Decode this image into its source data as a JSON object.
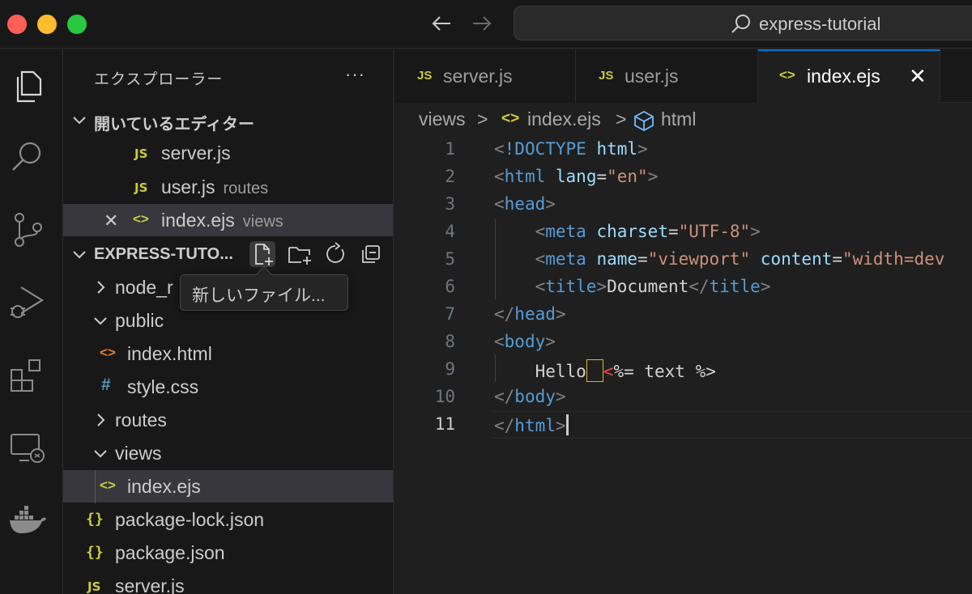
{
  "window": {
    "search_text": "express-tutorial"
  },
  "activity_bar": {
    "items": [
      "files-icon",
      "search-icon",
      "source-control-icon",
      "run-debug-icon",
      "extensions-icon",
      "remote-explorer-icon",
      "docker-icon"
    ]
  },
  "sidebar": {
    "title": "エクスプローラー",
    "more": "···",
    "open_editors_header": "開いているエディター",
    "open_editors": [
      {
        "name": "server.js",
        "desc": "",
        "icon": "JS"
      },
      {
        "name": "user.js",
        "desc": "routes",
        "icon": "JS"
      },
      {
        "name": "index.ejs",
        "desc": "views",
        "icon": "<>"
      }
    ],
    "project_header": "EXPRESS-TUTO...",
    "tooltip": "新しいファイル...",
    "tree": [
      {
        "name": "node_modules_visible",
        "label": "node_r"
      },
      {
        "label": "public"
      },
      {
        "label": "index.html",
        "icon": "<>"
      },
      {
        "label": "style.css",
        "icon": "#"
      },
      {
        "label": "routes"
      },
      {
        "label": "views"
      },
      {
        "label": "index.ejs",
        "icon": "<>"
      },
      {
        "label": "package-lock.json",
        "icon": "{}"
      },
      {
        "label": "package.json",
        "icon": "{}"
      },
      {
        "label": "server.js",
        "icon": "JS"
      }
    ]
  },
  "tabs": [
    {
      "label": "server.js",
      "icon": "JS"
    },
    {
      "label": "user.js",
      "icon": "JS"
    },
    {
      "label": "index.ejs",
      "icon": "<>",
      "close": "✕"
    }
  ],
  "breadcrumb": {
    "folder": "views",
    "file": "index.ejs",
    "symbol": "html",
    "sep": ">"
  },
  "editor": {
    "line_numbers": [
      "1",
      "2",
      "3",
      "4",
      "5",
      "6",
      "7",
      "8",
      "9",
      "10",
      "11"
    ],
    "current_line": "11",
    "lines": {
      "l1": {
        "br_open": "<",
        "tag": "!DOCTYPE",
        "sp": " ",
        "attr": "html",
        "br_close": ">"
      },
      "l2": {
        "br_open": "<",
        "tag": "html",
        "sp": " ",
        "attr": "lang",
        "eq": "=",
        "str": "\"en\"",
        "br_close": ">"
      },
      "l3": {
        "br_open": "<",
        "tag": "head",
        "br_close": ">"
      },
      "l4": {
        "indent": "    ",
        "br_open": "<",
        "tag": "meta",
        "sp": " ",
        "attr": "charset",
        "eq": "=",
        "str": "\"UTF-8\"",
        "br_close": ">"
      },
      "l5": {
        "indent": "    ",
        "br_open": "<",
        "tag": "meta",
        "sp": " ",
        "attr": "name",
        "eq": "=",
        "str": "\"viewport\"",
        "sp2": " ",
        "attr2": "content",
        "eq2": "=",
        "str2": "\"width=dev"
      },
      "l6": {
        "indent": "    ",
        "br_open": "<",
        "tag": "title",
        "br_close": ">",
        "text": "Document",
        "br_open2": "</",
        "tag2": "title",
        "br_close2": ">"
      },
      "l7": {
        "br_open": "</",
        "tag": "head",
        "br_close": ">"
      },
      "l8": {
        "br_open": "<",
        "tag": "body",
        "br_close": ">"
      },
      "l9": {
        "indent": "    ",
        "text": "Hello",
        "err": "<",
        "rest": "%= text %>"
      },
      "l10": {
        "br_open": "</",
        "tag": "body",
        "br_close": ">"
      },
      "l11": {
        "br_open": "</",
        "tag": "html",
        "br_close": ">"
      }
    }
  }
}
